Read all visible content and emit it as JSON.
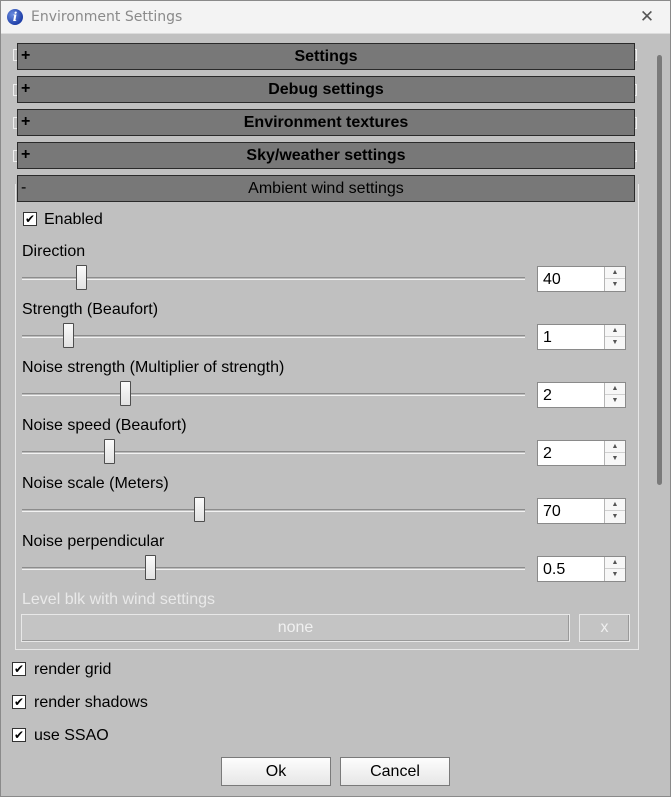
{
  "window": {
    "title": "Environment Settings",
    "app_icon": "info-icon",
    "close_glyph": "✕"
  },
  "sections": [
    {
      "toggle": "+",
      "label": "Settings",
      "expanded": false
    },
    {
      "toggle": "+",
      "label": "Debug settings",
      "expanded": false
    },
    {
      "toggle": "+",
      "label": "Environment textures",
      "expanded": false
    },
    {
      "toggle": "+",
      "label": "Sky/weather settings",
      "expanded": false
    },
    {
      "toggle": "-",
      "label": "Ambient wind settings",
      "expanded": true
    }
  ],
  "wind": {
    "enabled_label": "Enabled",
    "enabled_checked": true,
    "check_glyph": "✔",
    "sliders": [
      {
        "label": "Direction",
        "value": "40"
      },
      {
        "label": "Strength (Beaufort)",
        "value": "1"
      },
      {
        "label": "Noise strength (Multiplier of strength)",
        "value": "2"
      },
      {
        "label": "Noise speed (Beaufort)",
        "value": "2"
      },
      {
        "label": "Noise scale (Meters)",
        "value": "70"
      },
      {
        "label": "Noise perpendicular",
        "value": "0.5"
      }
    ],
    "spin_up": "▲",
    "spin_down": "▼",
    "level_label": "Level blk with wind settings",
    "level_value": "none",
    "level_clear": "x"
  },
  "render_options": [
    {
      "label": "render grid",
      "checked": true
    },
    {
      "label": "render shadows",
      "checked": true
    },
    {
      "label": "use SSAO",
      "checked": true
    }
  ],
  "buttons": {
    "ok": "Ok",
    "cancel": "Cancel"
  },
  "colors": {
    "background": "#c0c0c0",
    "section_header": "#787878",
    "disabled_text": "#e9e9e9"
  }
}
